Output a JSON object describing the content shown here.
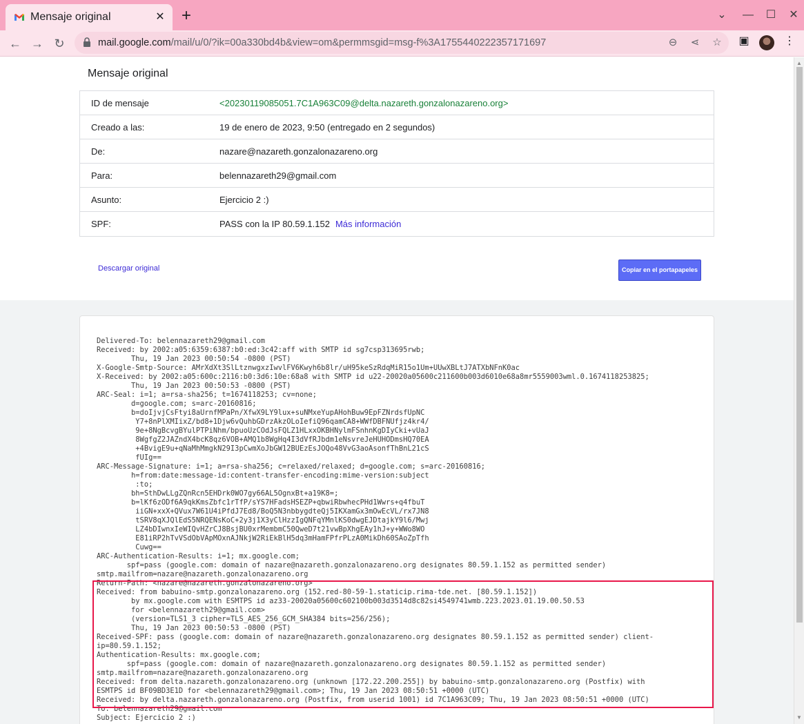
{
  "browser": {
    "tab_title": "Mensaje original",
    "tab_close": "✕",
    "new_tab": "+",
    "url_host": "mail.google.com",
    "url_path": "/mail/u/0/?ik=00a330bd4b&view=om&permmsgid=msg-f%3A1755440222357171697",
    "icons": [
      "gmail-icon",
      "back-icon",
      "forward-icon",
      "reload-icon",
      "lock-icon",
      "zoom-icon",
      "share-icon",
      "star-icon",
      "side-panel-icon",
      "avatar",
      "menu-icon"
    ]
  },
  "page": {
    "title": "Mensaje original",
    "fields": [
      {
        "key": "ID de mensaje",
        "value": "<20230119085051.7C1A963C09@delta.nazareth.gonzalonazareno.org>"
      },
      {
        "key": "Creado a las:",
        "value": "19 de enero de 2023, 9:50 (entregado en 2 segundos)"
      },
      {
        "key": "De:",
        "value": "nazare@nazareth.gonzalonazareno.org"
      },
      {
        "key": "Para:",
        "value": "belennazareth29@gmail.com"
      },
      {
        "key": "Asunto:",
        "value": "Ejercicio 2 :)"
      },
      {
        "key": "SPF:",
        "value": "PASS con la IP 80.59.1.152",
        "link": "Más información"
      }
    ],
    "download_label": "Descargar original",
    "copy_label": "Copiar en el portapapeles",
    "raw_lines": [
      "Delivered-To: belennazareth29@gmail.com",
      "Received: by 2002:a05:6359:6387:b0:ed:3c42:aff with SMTP id sg7csp313695rwb;",
      "        Thu, 19 Jan 2023 00:50:54 -0800 (PST)",
      "X-Google-Smtp-Source: AMrXdXt3SlLtznwgxzIwvlFV6Kwyh6b8lr/uH95keSzRdqMiR15o1Um+UUwXBLtJ7ATXbNFnK0ac",
      "X-Received: by 2002:a05:600c:2116:b0:3d6:10e:68a8 with SMTP id u22-20020a05600c211600b003d6010e68a8mr5559003wml.0.1674118253825;",
      "        Thu, 19 Jan 2023 00:50:53 -0800 (PST)",
      "ARC-Seal: i=1; a=rsa-sha256; t=1674118253; cv=none;",
      "        d=google.com; s=arc-20160816;",
      "        b=doIjvjCsFtyi8aUrnfMPaPn/XfwX9LY9lux+suNMxeYupAHohBuw9EpFZNrdsfUpNC",
      "         Y7+8nPlXMIixZ/bd8+1Djw6vQuhbGDrzAkzOLoIefiQ96qamCA8+WWfDBFNUfjz4kr4/",
      "         9e+8NgBcvgBYulPTPiNhm/bpuoUzCOdJsFQLZ1HLxxOKBHNylmFSnhnKgDIyCki+vUaJ",
      "         8WgfgZ2JAZndX4bcK8qz6VOB+AMQ1b8WgHq4I3dVfRJbdm1eNsvreJeHUHODmsHQ70EA",
      "         +4BvigE9u+qNaMhMmgkN29I3pCwmXoJbGW12BUEzEsJOQo48VvG3aoAsonfThBnL21cS",
      "         fUIg==",
      "ARC-Message-Signature: i=1; a=rsa-sha256; c=relaxed/relaxed; d=google.com; s=arc-20160816;",
      "        h=from:date:message-id:content-transfer-encoding:mime-version:subject",
      "         :to;",
      "        bh=SthDwLLgZQnRcn5EHDrk0WO7gy66AL5OgnxBt+a19K8=;",
      "        b=lKf6zODf6A9qkKmsZbfc1rTfP/sYS7HFadsHSEZP+qbwiRbwhecPHd1Wwrs+q4fbuT",
      "         iiGN+xxX+QVux7W61U4iPfdJ7Ed8/BoQ5N3nbbygdteQj5IKXamGx3mOwEcVL/rx7JN8",
      "         tSRV8qXJQlEdS5NRQENsKoC+2y3j1X3yClHzzIgQNFqYMnlKS0dwgEJDtajkY9l6/Mwj",
      "         LZ4bDIwnxIeWIQvHZrCJ8BsjBU0xrMembmC50QweD7t21vwBpXhgEAy1hJ+y+WWo8WO",
      "         E81iRP2hTvVSdObVApMOxnAJNkjW2RiEkBlH5dq3mHamFPfrPLzA0MikDh60SAoZpTfh",
      "         Cuwg==",
      "ARC-Authentication-Results: i=1; mx.google.com;",
      "       spf=pass (google.com: domain of nazare@nazareth.gonzalonazareno.org designates 80.59.1.152 as permitted sender)",
      "smtp.mailfrom=nazare@nazareth.gonzalonazareno.org",
      "Return-Path: <nazare@nazareth.gonzalonazareno.org>",
      "Received: from babuino-smtp.gonzalonazareno.org (152.red-80-59-1.staticip.rima-tde.net. [80.59.1.152])",
      "        by mx.google.com with ESMTPS id az33-20020a05600c602100b003d3514d8c82si4549741wmb.223.2023.01.19.00.50.53",
      "        for <belennazareth29@gmail.com>",
      "        (version=TLS1_3 cipher=TLS_AES_256_GCM_SHA384 bits=256/256);",
      "        Thu, 19 Jan 2023 00:50:53 -0800 (PST)",
      "Received-SPF: pass (google.com: domain of nazare@nazareth.gonzalonazareno.org designates 80.59.1.152 as permitted sender) client-",
      "ip=80.59.1.152;",
      "Authentication-Results: mx.google.com;",
      "       spf=pass (google.com: domain of nazare@nazareth.gonzalonazareno.org designates 80.59.1.152 as permitted sender)",
      "smtp.mailfrom=nazare@nazareth.gonzalonazareno.org",
      "Received: from delta.nazareth.gonzalonazareno.org (unknown [172.22.200.255]) by babuino-smtp.gonzalonazareno.org (Postfix) with",
      "ESMTPS id BF09BD3E1D for <belennazareth29@gmail.com>; Thu, 19 Jan 2023 08:50:51 +0000 (UTC)",
      "Received: by delta.nazareth.gonzalonazareno.org (Postfix, from userid 1001) id 7C1A963C09; Thu, 19 Jan 2023 08:50:51 +0000 (UTC)",
      "To: belennazareth29@gmail.com",
      "Subject: Ejercicio 2 :)"
    ]
  },
  "colors": {
    "tabbar": "#f7a6c1",
    "toolbar": "#fce4ec",
    "accent_button": "#5c6cf6",
    "message_id_green": "#188038",
    "highlight_red": "#e8174a"
  }
}
